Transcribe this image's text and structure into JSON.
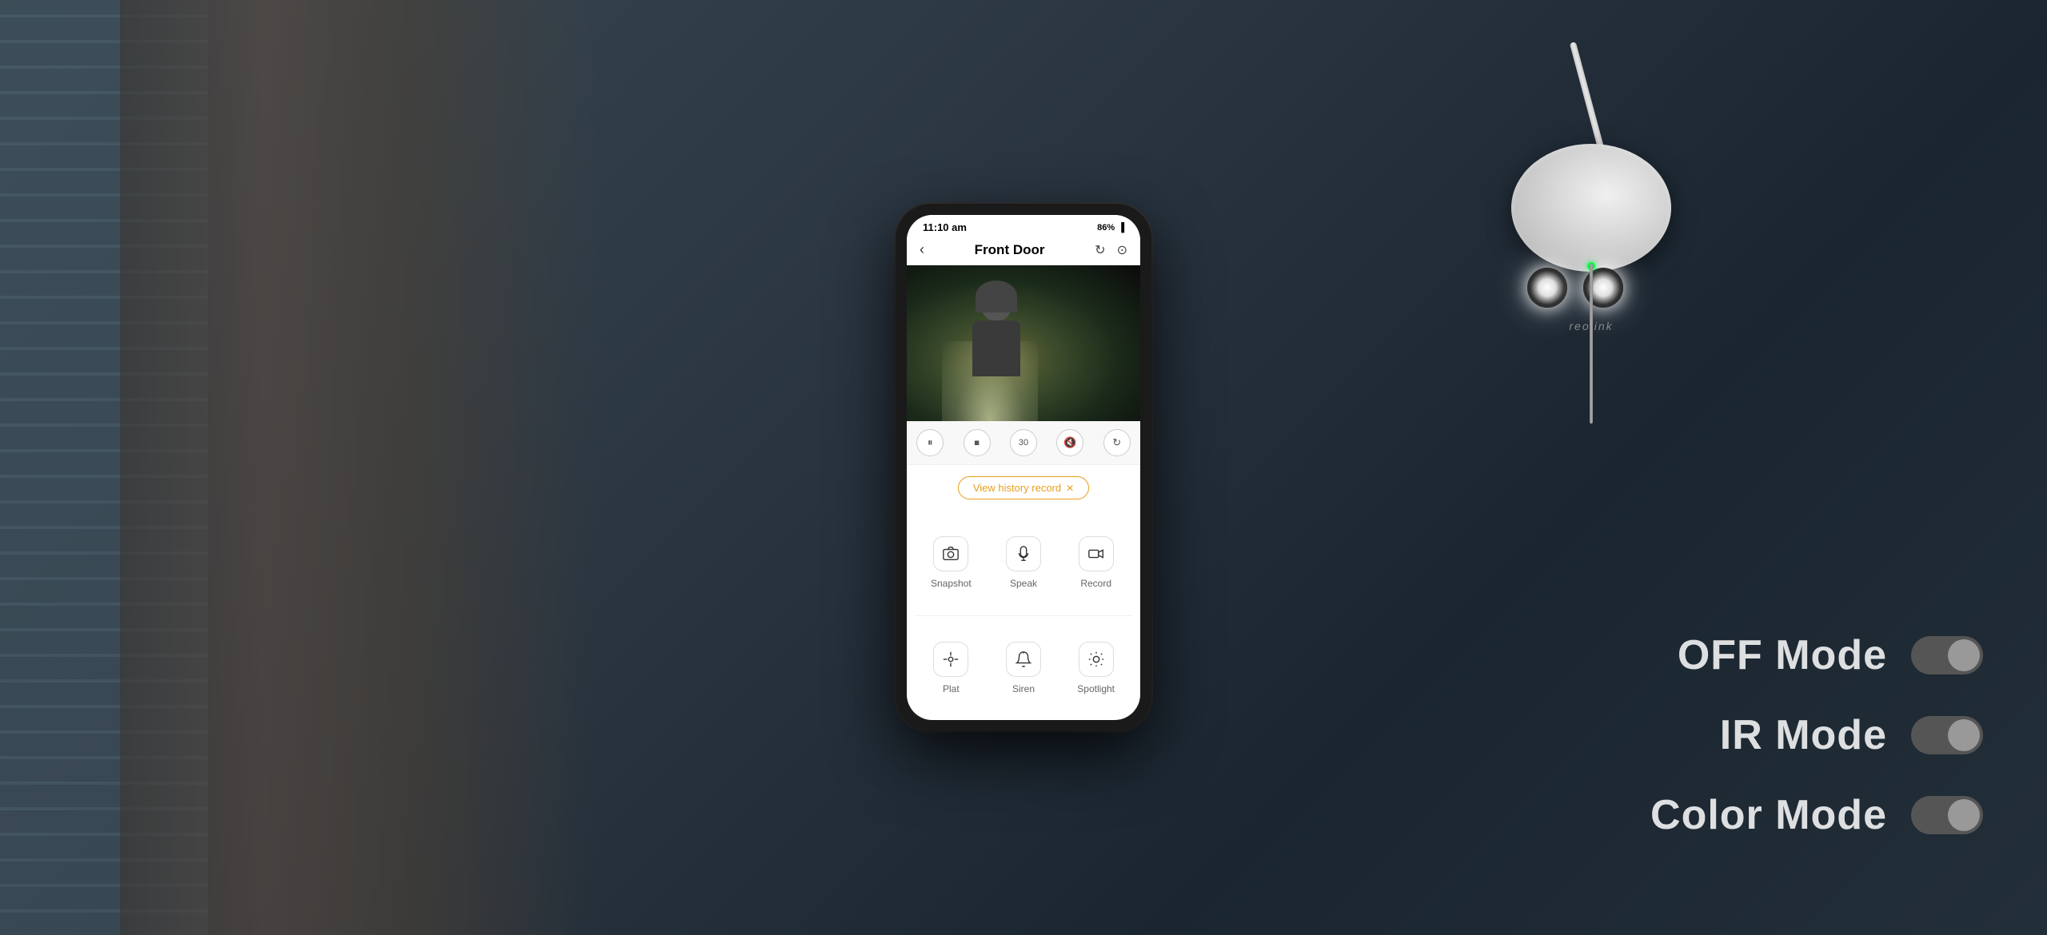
{
  "background": {
    "color": "#2a3540"
  },
  "phone": {
    "status_bar": {
      "time": "11:10 am",
      "battery": "86%",
      "battery_icon": "🔋"
    },
    "header": {
      "back_label": "‹",
      "title": "Front Door",
      "refresh_icon": "↻",
      "settings_icon": "⊙"
    },
    "playback_controls": {
      "pause_icon": "⏸",
      "stop_icon": "⏹",
      "rewind_icon": "↺",
      "volume_icon": "🔇",
      "rotate_icon": "⟳"
    },
    "history_button": {
      "label": "View history record",
      "close": "✕"
    },
    "actions": [
      {
        "icon": "📷",
        "label": "Snapshot",
        "unicode": "⊡"
      },
      {
        "icon": "🎤",
        "label": "Speak",
        "unicode": "♃"
      },
      {
        "icon": "📹",
        "label": "Record",
        "unicode": "▷"
      },
      {
        "icon": "✛",
        "label": "Plat",
        "unicode": "✛"
      },
      {
        "icon": "🔔",
        "label": "Siren",
        "unicode": "🔔"
      },
      {
        "icon": "💡",
        "label": "Spotlight",
        "unicode": "⊛"
      }
    ]
  },
  "modes": [
    {
      "label": "OFF Mode",
      "active": false
    },
    {
      "label": "IR Mode",
      "active": false
    },
    {
      "label": "Color Mode",
      "active": false
    }
  ],
  "colors": {
    "accent_orange": "#e8a020",
    "toggle_off": "#666666",
    "toggle_knob": "#999999"
  }
}
